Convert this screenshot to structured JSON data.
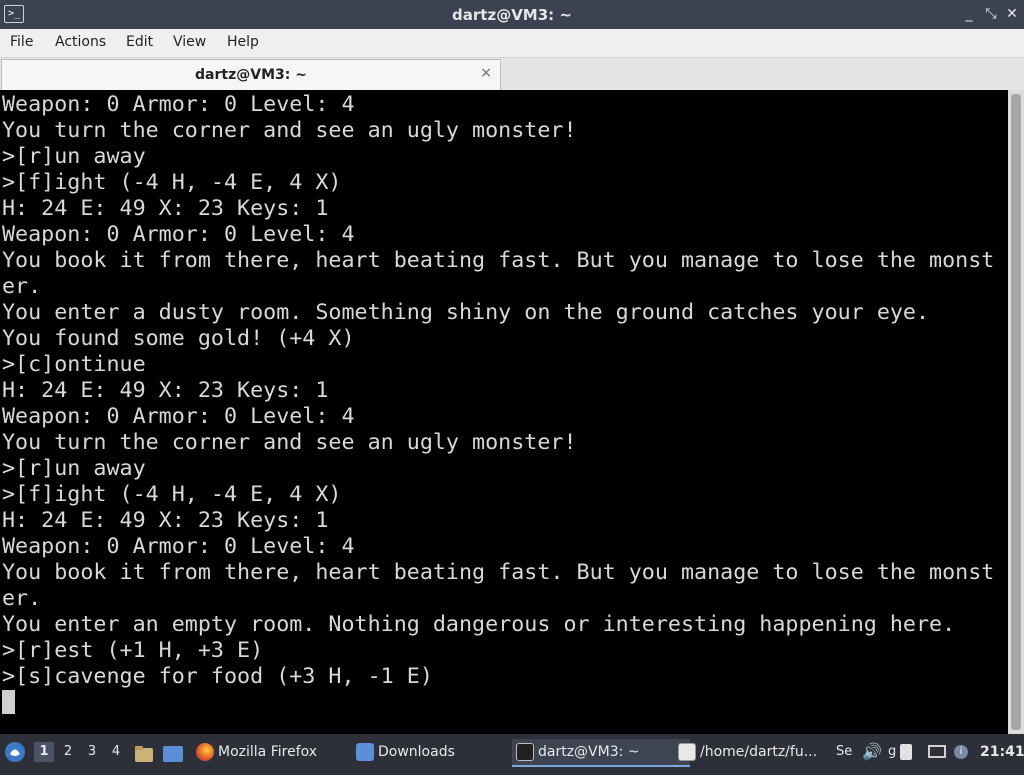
{
  "window": {
    "title": "dartz@VM3: ~",
    "app_icon_glyph": ">_"
  },
  "menu": [
    "File",
    "Actions",
    "Edit",
    "View",
    "Help"
  ],
  "tab": {
    "label": "dartz@VM3: ~",
    "close": "×"
  },
  "terminal": {
    "lines": [
      "Weapon: 0 Armor: 0 Level: 4",
      "You turn the corner and see an ugly monster!",
      ">[r]un away",
      ">[f]ight (-4 H, -4 E, 4 X)",
      "H: 24 E: 49 X: 23 Keys: 1",
      "Weapon: 0 Armor: 0 Level: 4",
      "You book it from there, heart beating fast. But you manage to lose the monst",
      "er.",
      "You enter a dusty room. Something shiny on the ground catches your eye.",
      "You found some gold! (+4 X)",
      ">[c]ontinue",
      "H: 24 E: 49 X: 23 Keys: 1",
      "Weapon: 0 Armor: 0 Level: 4",
      "You turn the corner and see an ugly monster!",
      ">[r]un away",
      ">[f]ight (-4 H, -4 E, 4 X)",
      "H: 24 E: 49 X: 23 Keys: 1",
      "Weapon: 0 Armor: 0 Level: 4",
      "You book it from there, heart beating fast. But you manage to lose the monst",
      "er.",
      "You enter an empty room. Nothing dangerous or interesting happening here.",
      ">[r]est (+1 H, +3 E)",
      ">[s]cavenge for food (+3 H, -1 E)"
    ]
  },
  "taskbar": {
    "workspaces": [
      "1",
      "2",
      "3",
      "4"
    ],
    "tasks": {
      "firefox": "Mozilla Firefox",
      "downloads": "Downloads",
      "terminal": "dartz@VM3: ~",
      "editor": "/home/dartz/fu..."
    },
    "tray_text": [
      "Se",
      "g"
    ],
    "clock": "21:41"
  },
  "colors": {
    "accent": "#7aa7e0",
    "terminal_bg": "#000000",
    "terminal_fg": "#d8d8d8"
  }
}
